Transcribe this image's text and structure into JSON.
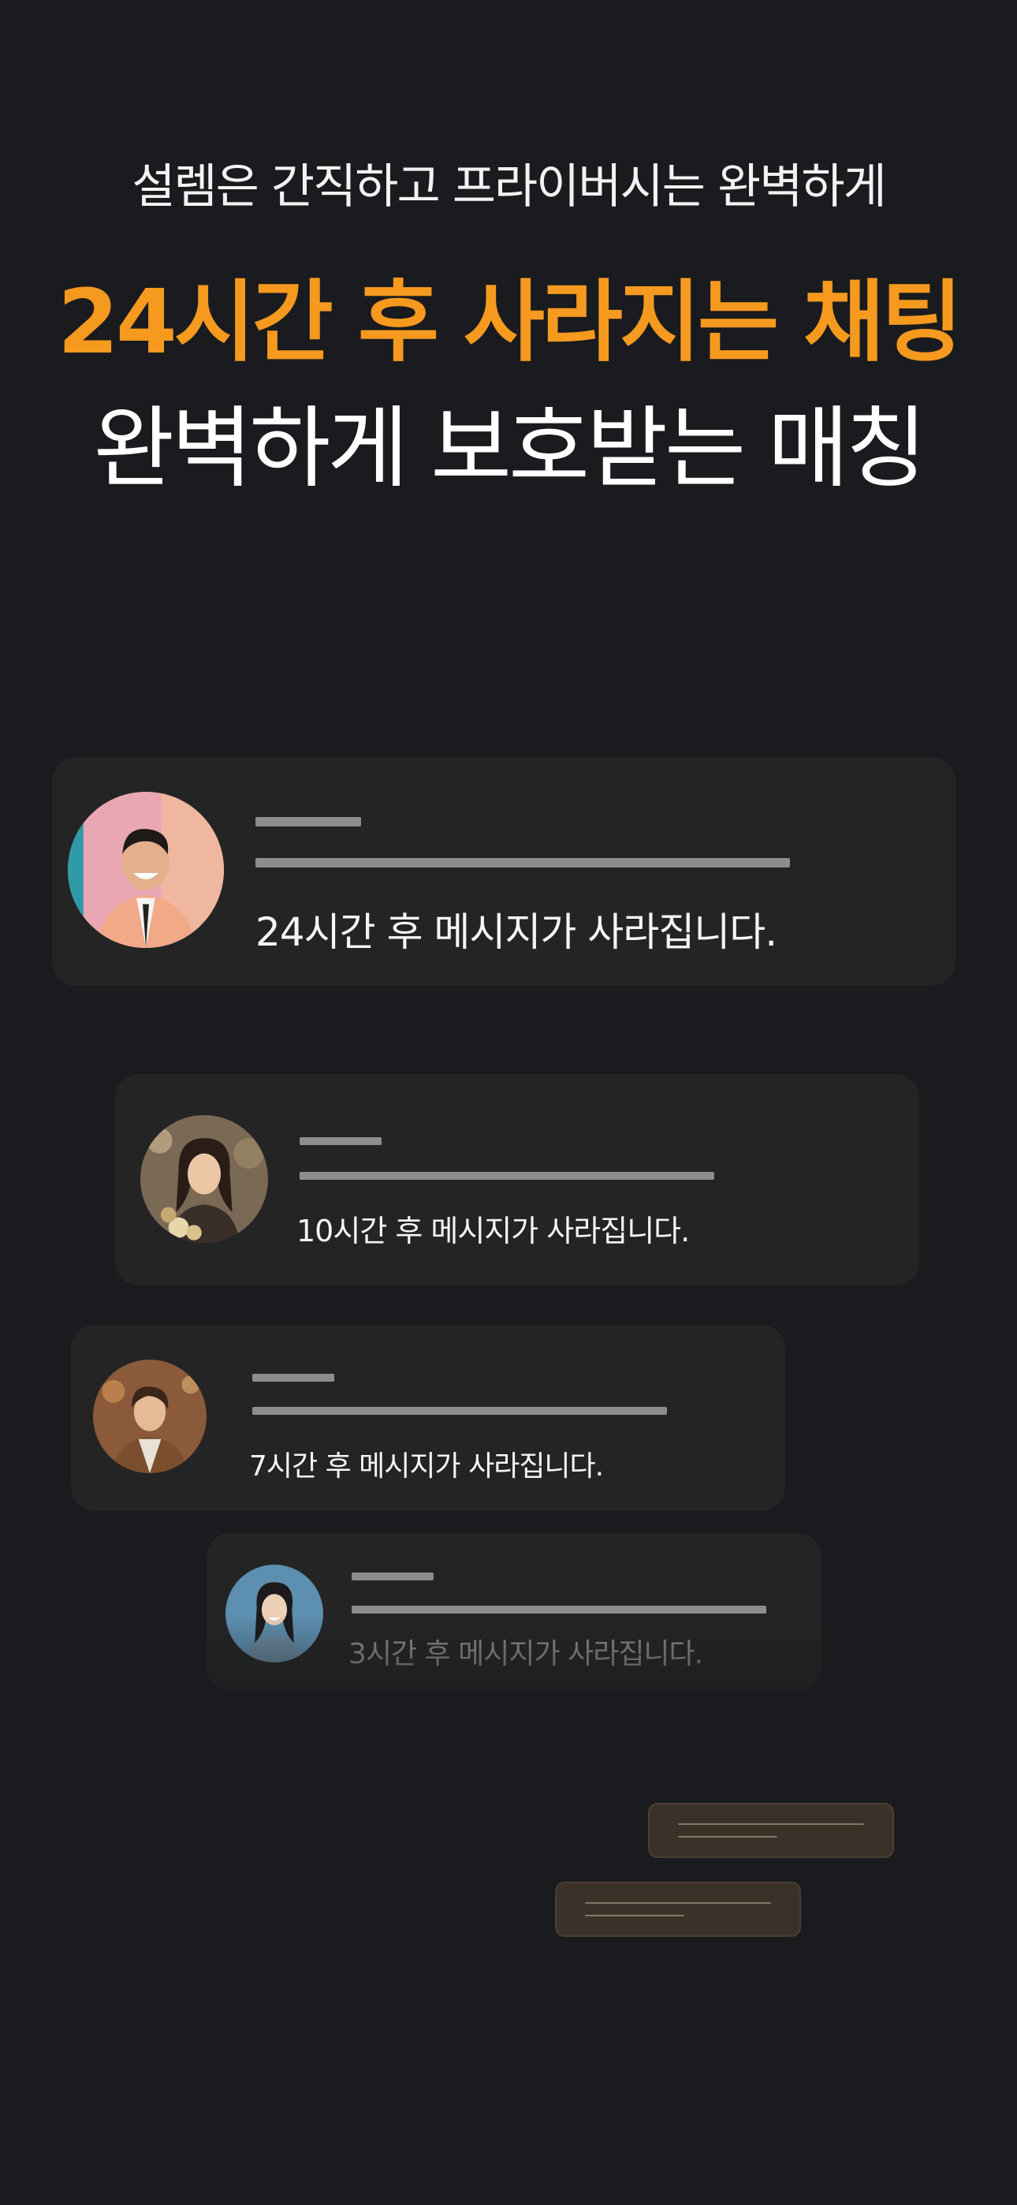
{
  "header": {
    "subtitle": "설렘은 간직하고 프라이버시는 완벽하게",
    "title_accent": "24시간 후 사라지는 채팅",
    "title_main": "완벽하게 보호받는 매칭"
  },
  "chats": [
    {
      "avatar": "avatar-man-peach-jacket",
      "message": "24시간 후 메시지가 사라집니다."
    },
    {
      "avatar": "avatar-woman-flowers",
      "message": "10시간 후 메시지가 사라집니다."
    },
    {
      "avatar": "avatar-man-brown-jacket",
      "message": "7시간 후 메시지가 사라집니다."
    },
    {
      "avatar": "avatar-woman-blue-background",
      "message": "3시간 후 메시지가 사라집니다."
    }
  ],
  "colors": {
    "background": "#1a1b1e",
    "accent": "#f59a1f",
    "card": "#242424",
    "placeholder_line": "#8d8d8d",
    "mini_bubble": "#3a3128"
  }
}
